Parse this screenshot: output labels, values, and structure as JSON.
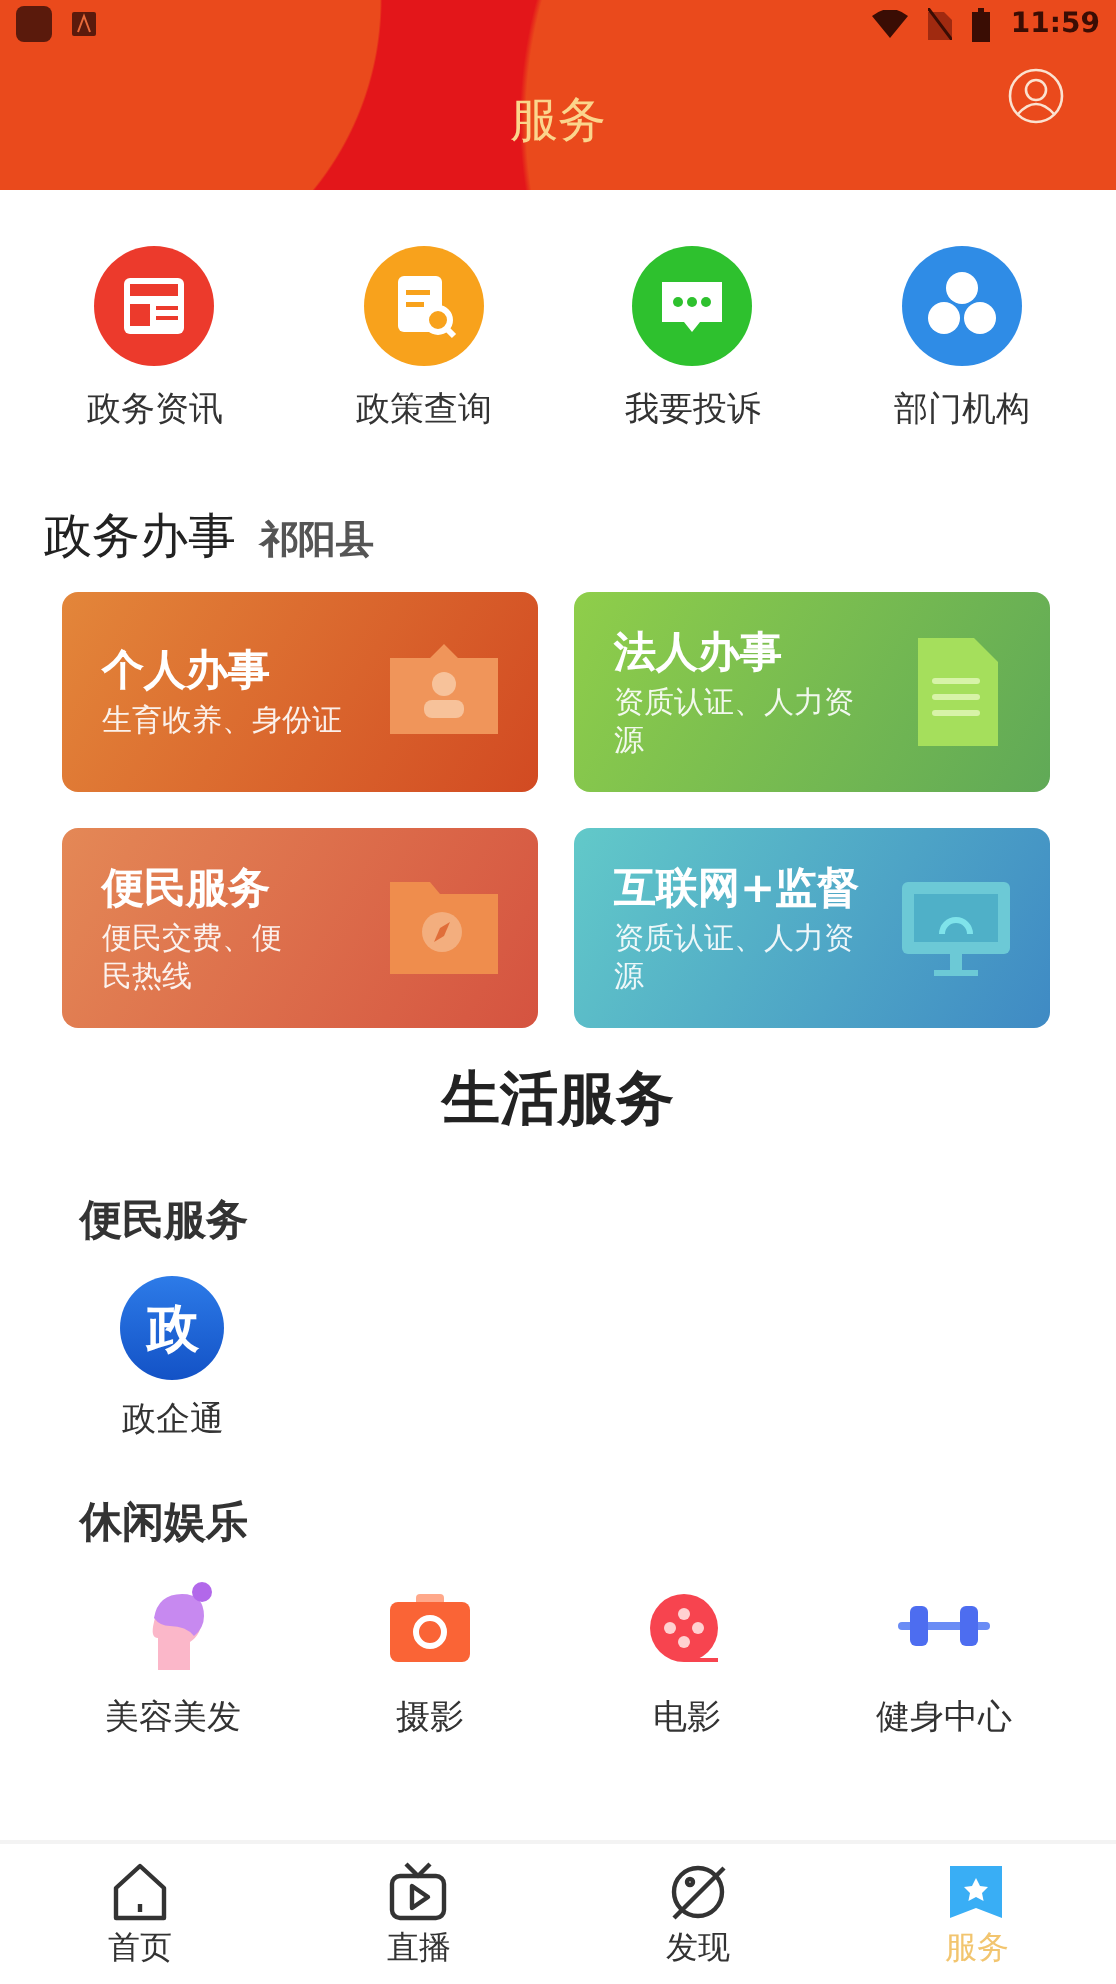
{
  "status_bar": {
    "time": "11:59"
  },
  "header": {
    "title": "服务"
  },
  "quick_links": [
    {
      "label": "政务资讯",
      "kind": "news"
    },
    {
      "label": "政策查询",
      "kind": "search"
    },
    {
      "label": "我要投诉",
      "kind": "chat"
    },
    {
      "label": "部门机构",
      "kind": "org"
    }
  ],
  "gov_section": {
    "title": "政务办事",
    "region": "祁阳县",
    "cards": [
      {
        "title": "个人办事",
        "subtitle": "生育收养、身份证",
        "kind": "person"
      },
      {
        "title": "法人办事",
        "subtitle": "资质认证、人力资源",
        "kind": "doc"
      },
      {
        "title": "便民服务",
        "subtitle": "便民交费、便民热线",
        "kind": "folder"
      },
      {
        "title": "互联网+监督",
        "subtitle": "资质认证、人力资源",
        "kind": "monitor"
      }
    ]
  },
  "life_section": {
    "title": "生活服务",
    "groups": [
      {
        "title": "便民服务",
        "items": [
          {
            "label": "政企通",
            "kind": "gov",
            "glyph": "政"
          }
        ]
      },
      {
        "title": "休闲娱乐",
        "items": [
          {
            "label": "美容美发",
            "kind": "beauty"
          },
          {
            "label": "摄影",
            "kind": "camera"
          },
          {
            "label": "电影",
            "kind": "film"
          },
          {
            "label": "健身中心",
            "kind": "fitness"
          }
        ]
      }
    ]
  },
  "bottom_nav": [
    {
      "label": "首页",
      "kind": "home",
      "selected": false
    },
    {
      "label": "直播",
      "kind": "tv",
      "selected": false
    },
    {
      "label": "发现",
      "kind": "planet",
      "selected": false
    },
    {
      "label": "服务",
      "kind": "service",
      "selected": true
    }
  ]
}
